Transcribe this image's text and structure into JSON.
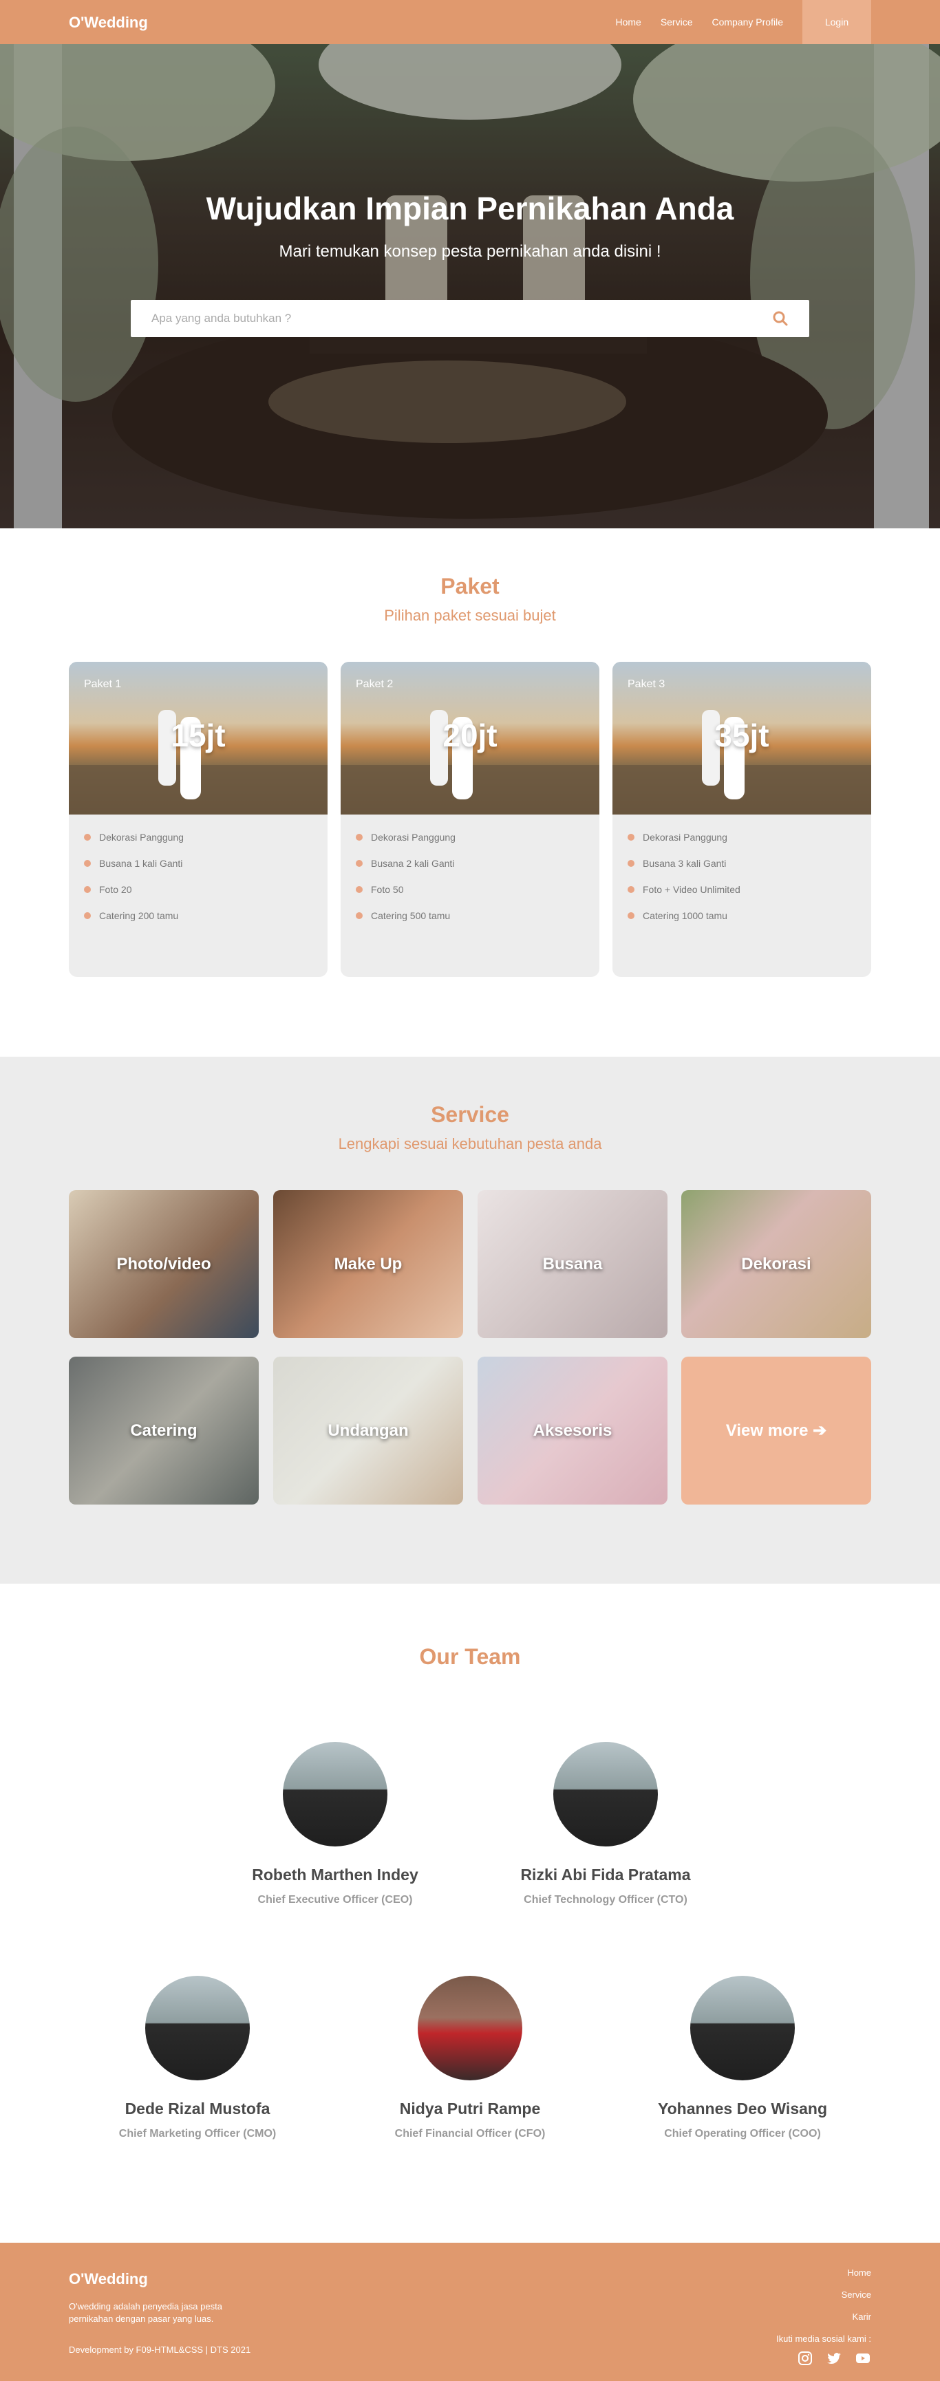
{
  "navbar": {
    "brand": "O'Wedding",
    "links": [
      "Home",
      "Service",
      "Company Profile"
    ],
    "login": "Login"
  },
  "hero": {
    "title": "Wujudkan Impian Pernikahan Anda",
    "subtitle": "Mari temukan konsep pesta pernikahan anda disini !",
    "search_placeholder": "Apa yang anda butuhkan ?",
    "search_icon": "search-icon"
  },
  "paket": {
    "title": "Paket",
    "subtitle": "Pilihan paket sesuai bujet",
    "cards": [
      {
        "label": "Paket 1",
        "price": "15jt",
        "features": [
          "Dekorasi Panggung",
          "Busana 1 kali Ganti",
          "Foto 20",
          "Catering 200 tamu"
        ]
      },
      {
        "label": "Paket 2",
        "price": "20jt",
        "features": [
          "Dekorasi Panggung",
          "Busana 2 kali Ganti",
          "Foto 50",
          "Catering 500 tamu"
        ]
      },
      {
        "label": "Paket 3",
        "price": "35jt",
        "features": [
          "Dekorasi Panggung",
          "Busana 3 kali Ganti",
          "Foto + Video Unlimited",
          "Catering 1000 tamu"
        ]
      }
    ]
  },
  "service": {
    "title": "Service",
    "subtitle": "Lengkapi sesuai kebutuhan pesta anda",
    "tiles": [
      "Photo/video",
      "Make Up",
      "Busana",
      "Dekorasi",
      "Catering",
      "Undangan",
      "Aksesoris"
    ],
    "view_more": "View more ➔"
  },
  "team": {
    "title": "Our Team",
    "members": [
      {
        "name": "Robeth Marthen Indey",
        "role": "Chief Executive Officer (CEO)"
      },
      {
        "name": "Rizki Abi Fida Pratama",
        "role": "Chief Technology Officer (CTO)"
      },
      {
        "name": "Dede Rizal Mustofa",
        "role": "Chief Marketing Officer (CMO)"
      },
      {
        "name": "Nidya Putri Rampe",
        "role": "Chief Financial Officer (CFO)"
      },
      {
        "name": "Yohannes Deo Wisang",
        "role": "Chief Operating Officer (COO)"
      }
    ]
  },
  "footer": {
    "brand": "O'Wedding",
    "description": "O'wedding adalah penyedia jasa pesta pernikahan dengan pasar yang luas.",
    "dev": "Development by   F09-HTML&CSS | DTS 2021",
    "links": [
      "Home",
      "Service",
      "Karir"
    ],
    "social_label": "Ikuti media sosial kami :",
    "social_icons": [
      "instagram-icon",
      "twitter-icon",
      "youtube-icon"
    ]
  },
  "colors": {
    "accent": "#e0996e",
    "accent_light": "#f0b697",
    "card_bg": "#ededed",
    "section_bg": "#ececec"
  }
}
